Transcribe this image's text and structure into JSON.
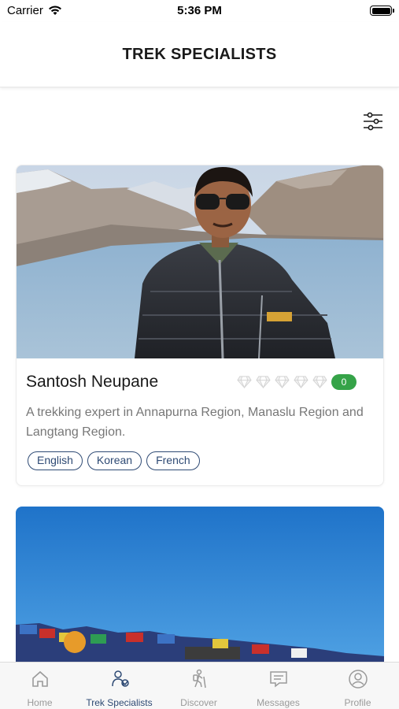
{
  "status_bar": {
    "carrier": "Carrier",
    "time": "5:36 PM"
  },
  "header": {
    "title": "TREK SPECIALISTS"
  },
  "filter": {
    "icon": "sliders-icon"
  },
  "specialists": [
    {
      "name": "Santosh Neupane",
      "rating_icons": 5,
      "rating_count": "0",
      "description": "A trekking expert in Annapurna Region, Manaslu Region and Langtang Region.",
      "languages": [
        "English",
        "Korean",
        "French"
      ]
    }
  ],
  "colors": {
    "accent": "#2e4a74",
    "badge": "#35a348",
    "muted": "#9a9a9a"
  },
  "tab_bar": {
    "tabs": [
      {
        "label": "Home",
        "icon": "home-icon"
      },
      {
        "label": "Trek Specialists",
        "icon": "trekker-icon",
        "active": true
      },
      {
        "label": "Discover",
        "icon": "hiker-icon"
      },
      {
        "label": "Messages",
        "icon": "message-icon"
      },
      {
        "label": "Profile",
        "icon": "user-icon"
      }
    ]
  }
}
